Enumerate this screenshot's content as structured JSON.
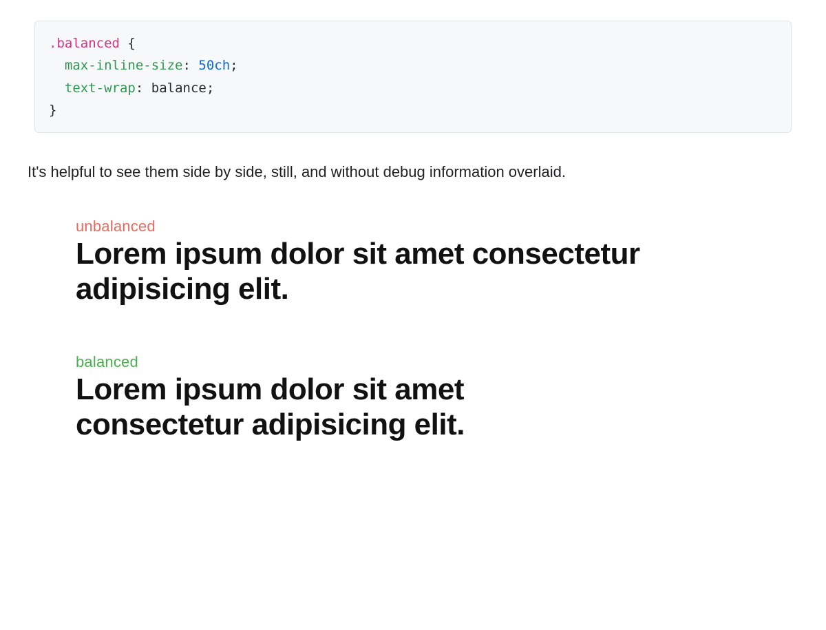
{
  "code": {
    "selector": ".balanced",
    "brace_open": " {",
    "brace_close": "}",
    "indent": "  ",
    "rules": [
      {
        "prop": "max-inline-size",
        "colon": ":",
        "space": " ",
        "value_num": "50",
        "value_unit": "ch",
        "semicolon": ";"
      },
      {
        "prop": "text-wrap",
        "colon": ":",
        "space": " ",
        "value": "balance",
        "semicolon": ";"
      }
    ]
  },
  "prose": {
    "paragraph": "It's helpful to see them side by side, still, and without debug information overlaid."
  },
  "examples": {
    "unbalanced": {
      "label": "unbalanced",
      "text": "Lorem ipsum dolor sit amet consectetur adipisicing elit."
    },
    "balanced": {
      "label": "balanced",
      "text": "Lorem ipsum dolor sit amet consectetur adipisicing elit."
    }
  },
  "colors": {
    "unbalanced_label": "#e86a5e",
    "balanced_label": "#4caf50",
    "code_bg": "#f6f8fa"
  }
}
